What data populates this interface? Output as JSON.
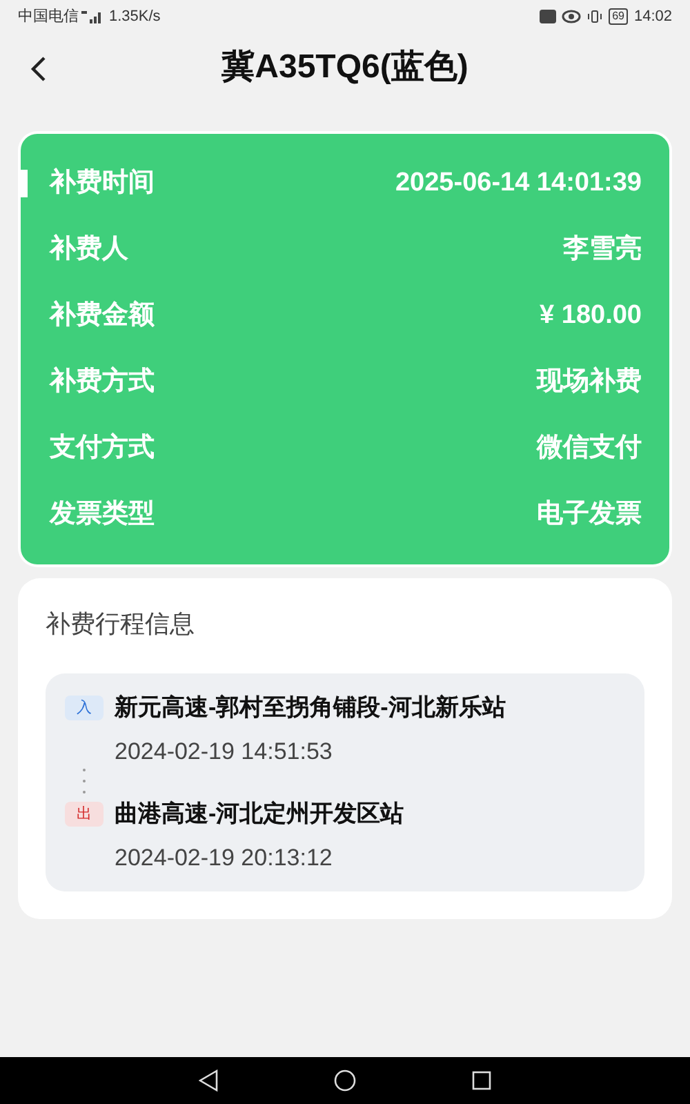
{
  "status_bar": {
    "carrier": "中国电信",
    "speed": "1.35K/s",
    "battery": "69",
    "time": "14:02"
  },
  "header": {
    "title": "冀A35TQ6(蓝色)"
  },
  "details": [
    {
      "label": "补费时间",
      "value": "2025-06-14 14:01:39",
      "selected": true
    },
    {
      "label": "补费人",
      "value": "李雪亮",
      "selected": false
    },
    {
      "label": "补费金额",
      "value": "¥ 180.00",
      "selected": false
    },
    {
      "label": "补费方式",
      "value": "现场补费",
      "selected": false
    },
    {
      "label": "支付方式",
      "value": "微信支付",
      "selected": false
    },
    {
      "label": "发票类型",
      "value": "电子发票",
      "selected": false
    }
  ],
  "trip": {
    "title": "补费行程信息",
    "stops": [
      {
        "kind": "entry",
        "badge": "入",
        "station": "新元高速-郭村至拐角铺段-河北新乐站",
        "time": "2024-02-19 14:51:53"
      },
      {
        "kind": "exit",
        "badge": "出",
        "station": "曲港高速-河北定州开发区站",
        "time": "2024-02-19 20:13:12"
      }
    ]
  }
}
